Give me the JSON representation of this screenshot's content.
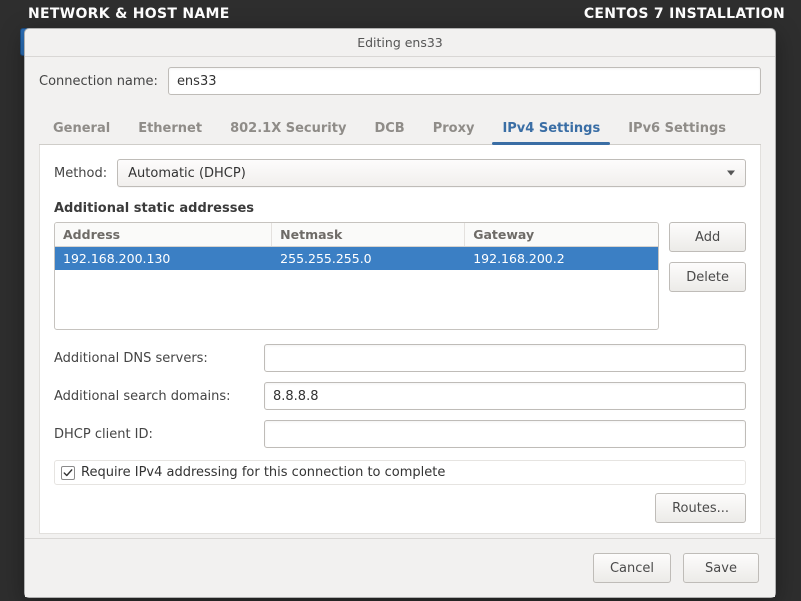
{
  "bg": {
    "left_title": "NETWORK & HOST NAME",
    "right_title": "CENTOS 7 INSTALLATION"
  },
  "dialog": {
    "title": "Editing ens33",
    "connection_name_label": "Connection name:",
    "connection_name_value": "ens33",
    "footer": {
      "cancel": "Cancel",
      "save": "Save"
    }
  },
  "tabs": [
    {
      "label": "General"
    },
    {
      "label": "Ethernet"
    },
    {
      "label": "802.1X Security"
    },
    {
      "label": "DCB"
    },
    {
      "label": "Proxy"
    },
    {
      "label": "IPv4 Settings",
      "active": true
    },
    {
      "label": "IPv6 Settings"
    }
  ],
  "ipv4": {
    "method_label": "Method:",
    "method_value": "Automatic (DHCP)",
    "addresses_section": "Additional static addresses",
    "table": {
      "headers": {
        "address": "Address",
        "netmask": "Netmask",
        "gateway": "Gateway"
      },
      "rows": [
        {
          "address": "192.168.200.130",
          "netmask": "255.255.255.0",
          "gateway": "192.168.200.2",
          "selected": true
        }
      ]
    },
    "buttons": {
      "add": "Add",
      "delete": "Delete"
    },
    "dns_label": "Additional DNS servers:",
    "dns_value": "",
    "search_label": "Additional search domains:",
    "search_value": "8.8.8.8",
    "dhcp_client_label": "DHCP client ID:",
    "dhcp_client_value": "",
    "require_checked": true,
    "require_label": "Require IPv4 addressing for this connection to complete",
    "routes": "Routes..."
  }
}
